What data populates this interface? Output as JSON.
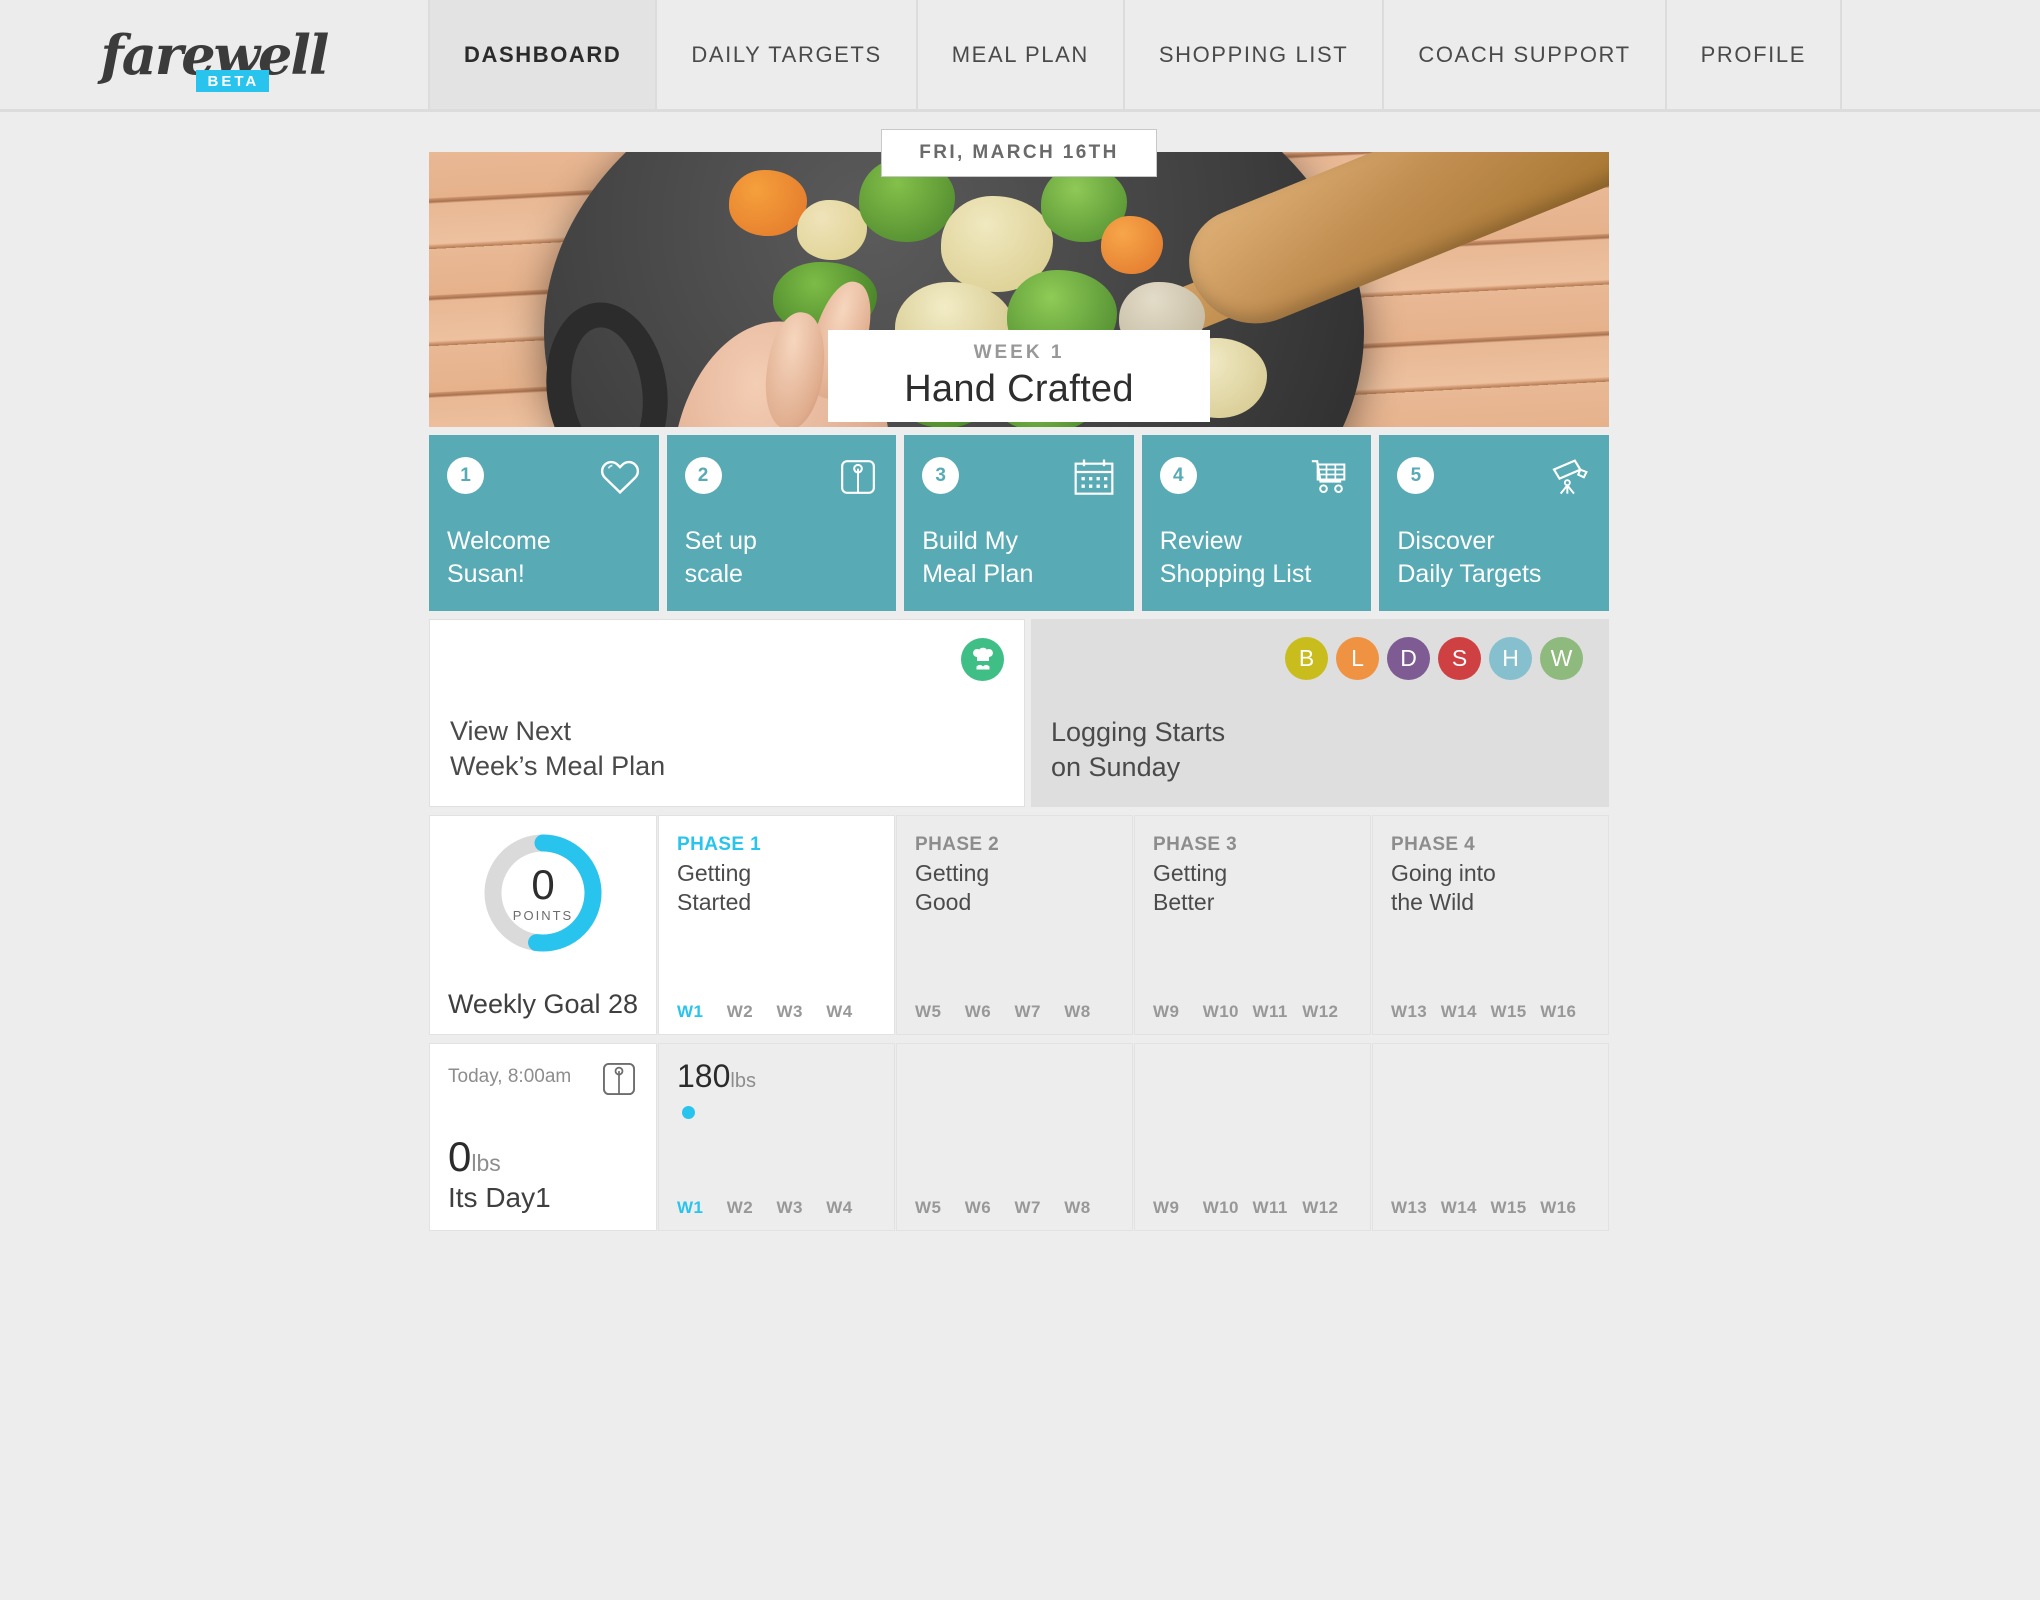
{
  "brand": {
    "name": "farewell",
    "badge": "BETA"
  },
  "nav": {
    "tabs": [
      {
        "label": "DASHBOARD",
        "active": true
      },
      {
        "label": "DAILY TARGETS",
        "active": false
      },
      {
        "label": "MEAL PLAN",
        "active": false
      },
      {
        "label": "SHOPPING LIST",
        "active": false
      },
      {
        "label": "COACH SUPPORT",
        "active": false
      },
      {
        "label": "PROFILE",
        "active": false
      }
    ]
  },
  "hero": {
    "date_chip": "FRI, MARCH 16TH",
    "week_label": "WEEK 1",
    "week_name": "Hand Crafted"
  },
  "steps": [
    {
      "num": "1",
      "line1": "Welcome",
      "line2": "Susan!",
      "icon": "heart-icon"
    },
    {
      "num": "2",
      "line1": "Set up",
      "line2": "scale",
      "icon": "scale-icon"
    },
    {
      "num": "3",
      "line1": "Build My",
      "line2": "Meal Plan",
      "icon": "calendar-icon"
    },
    {
      "num": "4",
      "line1": "Review",
      "line2": "Shopping List",
      "icon": "shopping-cart-icon"
    },
    {
      "num": "5",
      "line1": "Discover",
      "line2": "Daily Targets",
      "icon": "telescope-icon"
    }
  ],
  "meal_card": {
    "line1": "View Next",
    "line2": "Week’s Meal Plan",
    "icon": "chef-hat-icon",
    "icon_color": "#3fbf85"
  },
  "logging_card": {
    "line1": "Logging Starts",
    "line2": "on Sunday",
    "meal_dots": [
      {
        "letter": "B",
        "color": "#c9bd1e"
      },
      {
        "letter": "L",
        "color": "#ef9343"
      },
      {
        "letter": "D",
        "color": "#7e5b92"
      },
      {
        "letter": "S",
        "color": "#cf4043"
      },
      {
        "letter": "H",
        "color": "#86c0ce"
      },
      {
        "letter": "W",
        "color": "#8fba7e"
      }
    ]
  },
  "points": {
    "value": "0",
    "unit": "POINTS",
    "goal_label": "Weekly Goal 28",
    "percent": 52,
    "ring_color": "#29c4ee",
    "track_color": "#dadada"
  },
  "phases": [
    {
      "header": "PHASE 1",
      "line1": "Getting",
      "line2": "Started",
      "weeks": [
        "W1",
        "W2",
        "W3",
        "W4"
      ],
      "current": true,
      "current_week": "W1"
    },
    {
      "header": "PHASE 2",
      "line1": "Getting",
      "line2": "Good",
      "weeks": [
        "W5",
        "W6",
        "W7",
        "W8"
      ],
      "current": false,
      "current_week": ""
    },
    {
      "header": "PHASE 3",
      "line1": "Getting",
      "line2": "Better",
      "weeks": [
        "W9",
        "W10",
        "W11",
        "W12"
      ],
      "current": false,
      "current_week": ""
    },
    {
      "header": "PHASE 4",
      "line1": "Going into",
      "line2": "the Wild",
      "weeks": [
        "W13",
        "W14",
        "W15",
        "W16"
      ],
      "current": false,
      "current_week": ""
    }
  ],
  "weight": {
    "timestamp": "Today, 8:00am",
    "icon": "scale-icon",
    "change_value": "0",
    "change_unit": "lbs",
    "day_label": "Its Day1"
  },
  "chart_data": {
    "type": "scatter",
    "title": "",
    "xlabel": "",
    "ylabel": "lbs",
    "current_value": 180,
    "current_value_label": "180",
    "unit": "lbs",
    "point_color": "#29c4ee",
    "categories": [
      "W1",
      "W2",
      "W3",
      "W4",
      "W5",
      "W6",
      "W7",
      "W8",
      "W9",
      "W10",
      "W11",
      "W12",
      "W13",
      "W14",
      "W15",
      "W16"
    ],
    "values": [
      180,
      null,
      null,
      null,
      null,
      null,
      null,
      null,
      null,
      null,
      null,
      null,
      null,
      null,
      null,
      null
    ],
    "active_week": "W1",
    "grid": false,
    "legend": "none",
    "groups": [
      {
        "weeks": [
          "W1",
          "W2",
          "W3",
          "W4"
        ]
      },
      {
        "weeks": [
          "W5",
          "W6",
          "W7",
          "W8"
        ]
      },
      {
        "weeks": [
          "W9",
          "W10",
          "W11",
          "W12"
        ]
      },
      {
        "weeks": [
          "W13",
          "W14",
          "W15",
          "W16"
        ]
      }
    ]
  }
}
